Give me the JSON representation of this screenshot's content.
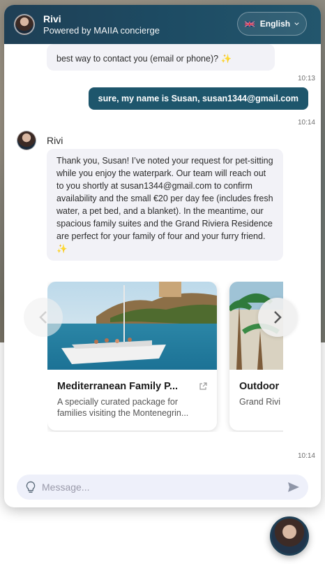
{
  "header": {
    "name": "Rivi",
    "subtitle": "Powered by MAIIA concierge",
    "language": "English"
  },
  "messages": {
    "bot_partial": "best way to contact you (email or phone)? ✨",
    "time1": "10:13",
    "user_text": "sure, my name is Susan, susan1344@gmail.com",
    "time2": "10:14",
    "bot_name": "Rivi",
    "bot_reply": "Thank you, Susan! I’ve noted your request for pet-sitting while you enjoy the waterpark. Our team will reach out to you shortly at susan1344@gmail.com to confirm availability and the small €20 per day fee (includes fresh water, a pet bed, and a blanket). In the meantime, our spacious family suites and the Grand Riviera Residence are perfect for your family of four and your furry friend. ✨",
    "time3": "10:14"
  },
  "cards": [
    {
      "title": "Mediterranean Family P...",
      "description": "A specially curated package for families visiting the Montenegrin..."
    },
    {
      "title": "Outdoor",
      "description": "Grand Rivi is the high"
    }
  ],
  "composer": {
    "placeholder": "Message..."
  },
  "icons": {
    "flag": "uk-flag-icon",
    "chevron": "chevron-down-icon",
    "prev": "chevron-left-icon",
    "next": "chevron-right-icon",
    "external": "external-link-icon",
    "idea": "lightbulb-icon",
    "send": "send-icon"
  },
  "colors": {
    "header": "#1f3f55",
    "user_bubble": "#1e566c",
    "bot_bubble": "#f2f2f7",
    "input_bg": "#eef0fa"
  }
}
